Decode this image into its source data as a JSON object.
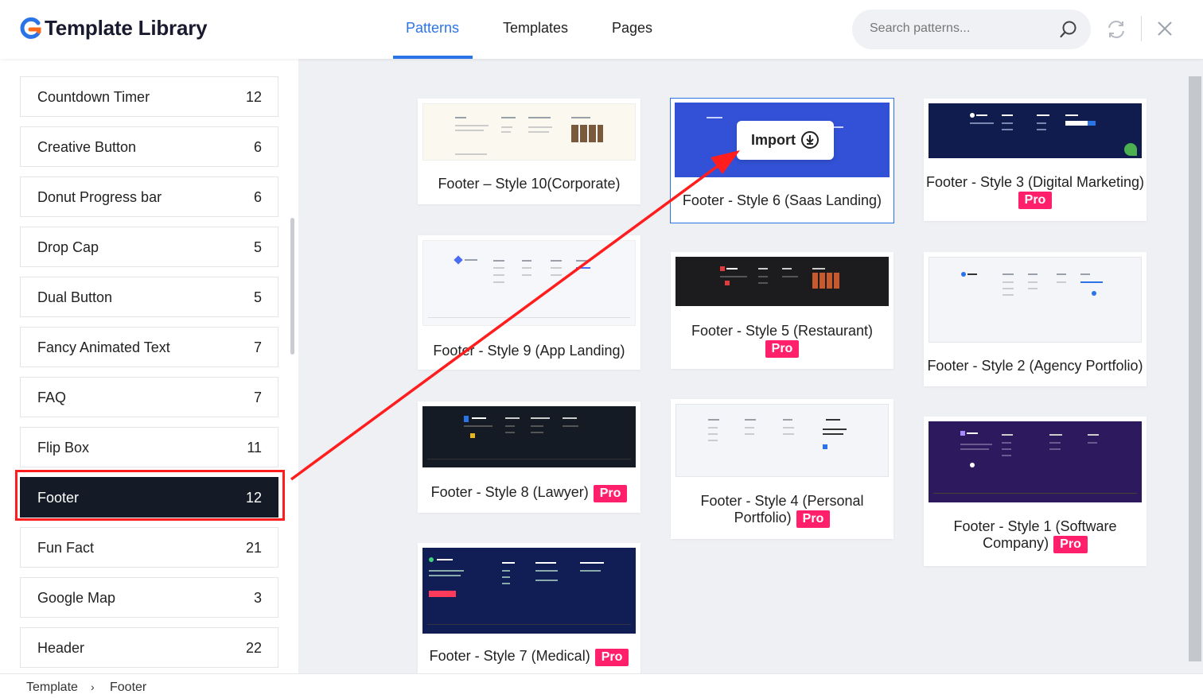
{
  "header": {
    "title": "Template Library",
    "tabs": [
      {
        "label": "Patterns",
        "active": true
      },
      {
        "label": "Templates",
        "active": false
      },
      {
        "label": "Pages",
        "active": false
      }
    ],
    "search_placeholder": "Search patterns...",
    "accent_color": "#2b74e8"
  },
  "sidebar": {
    "items": [
      {
        "label": "Countdown Timer",
        "count": "12"
      },
      {
        "label": "Creative Button",
        "count": "6"
      },
      {
        "label": "Donut Progress bar",
        "count": "6"
      },
      {
        "label": "Drop Cap",
        "count": "5"
      },
      {
        "label": "Dual Button",
        "count": "5"
      },
      {
        "label": "Fancy Animated Text",
        "count": "7"
      },
      {
        "label": "FAQ",
        "count": "7"
      },
      {
        "label": "Flip Box",
        "count": "11"
      },
      {
        "label": "Footer",
        "count": "12",
        "active": true
      },
      {
        "label": "Fun Fact",
        "count": "21"
      },
      {
        "label": "Google Map",
        "count": "3"
      },
      {
        "label": "Header",
        "count": "22"
      }
    ]
  },
  "cards": {
    "c1": {
      "title": "Footer – Style 10(Corporate)"
    },
    "c2": {
      "title": "Footer - Style 9 (App Landing)"
    },
    "c3": {
      "title": "Footer - Style 8 (Lawyer)",
      "badge": "Pro"
    },
    "c4": {
      "title": "Footer - Style 7 (Medical)",
      "badge": "Pro"
    },
    "c5": {
      "title": "Footer - Style 6 (Saas Landing)",
      "import_label": "Import"
    },
    "c6": {
      "title": "Footer - Style 5 (Restaurant)",
      "badge": "Pro"
    },
    "c7": {
      "title_line1": "Footer - Style 4 (Personal",
      "title_line2": "Portfolio)",
      "badge": "Pro"
    },
    "c8": {
      "title": "Footer - Style 3 (Digital Marketing)",
      "badge": "Pro"
    },
    "c9": {
      "title": "Footer - Style 2 (Agency Portfolio)"
    },
    "c10": {
      "title_line1": "Footer - Style 1 (Software",
      "title_line2": "Company)",
      "badge": "Pro"
    }
  },
  "breadcrumb": {
    "root": "Template",
    "separator": "›",
    "current": "Footer"
  },
  "colors": {
    "pro_badge": "#ff1f6b",
    "annotation": "#ff1d1d",
    "active_item_bg": "#141a26"
  }
}
